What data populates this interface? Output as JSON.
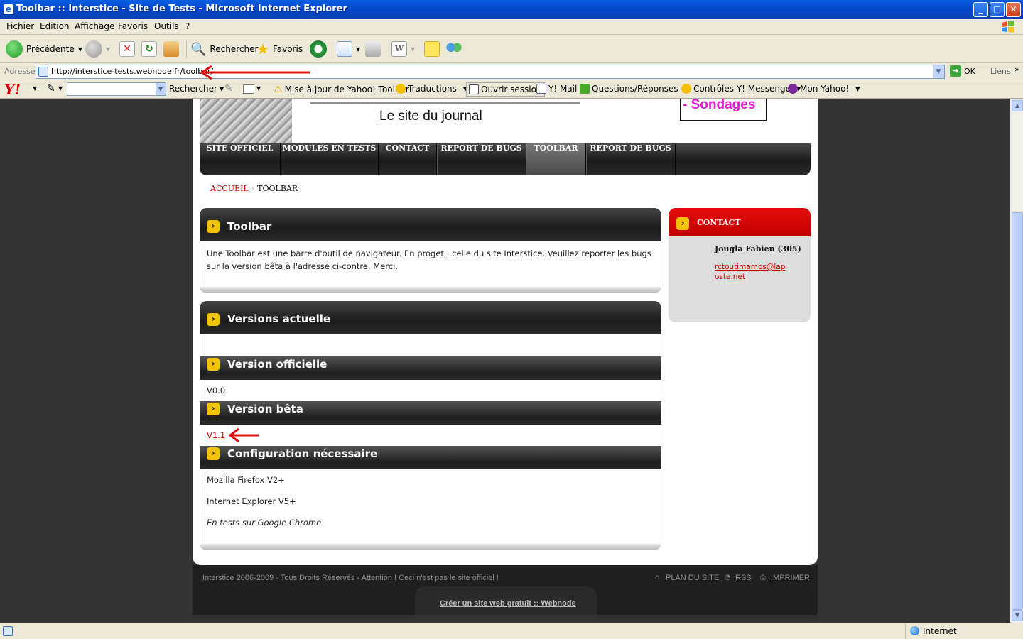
{
  "window": {
    "title": "Toolbar :: Interstice - Site de Tests - Microsoft Internet Explorer",
    "min": "_",
    "max": "□",
    "close": "✕"
  },
  "menu": [
    "Fichier",
    "Edition",
    "Affichage",
    "Favoris",
    "Outils",
    "?"
  ],
  "toolbar": {
    "back": "Précédente",
    "search": "Rechercher",
    "favorites": "Favoris"
  },
  "address": {
    "label": "Adresse",
    "url": "http://interstice-tests.webnode.fr/toolbar/",
    "go": "OK",
    "links": "Liens"
  },
  "yahoo": {
    "search_label": "Rechercher",
    "update": "Mise à jour de Yahoo! Toolbar",
    "translations": "Traductions",
    "session": "Ouvrir session",
    "mail": "Y! Mail",
    "answers": "Questions/Réponses",
    "messenger": "Contrôles Y! Messenger",
    "my_yahoo": "Mon Yahoo!"
  },
  "site": {
    "journal": "Le site du journal",
    "sondages": "- Sondages",
    "nav": [
      "SITE OFFICIEL",
      "MODULES EN TESTS",
      "CONTACT",
      "REPORT DE BUGS",
      "TOOLBAR",
      "REPORT DE BUGS"
    ],
    "breadcrumb": {
      "home": "ACCUEIL",
      "current": "TOOLBAR"
    },
    "toolbar_box": {
      "title": "Toolbar",
      "text": "Une Toolbar est une barre d'outil de navigateur. En proget : celle du site Interstice. Veuillez reporter les bugs sur la version bêta à l'adresse ci-contre. Merci."
    },
    "versions_box": {
      "title": "Versions actuelle",
      "official_title": "Version officielle",
      "official_value": "V0.0",
      "beta_title": "Version bêta",
      "beta_value": "V1.1",
      "config_title": "Configuration nécessaire",
      "config": [
        "Mozilla Firefox V2+",
        "Internet Explorer V5+",
        "En tests sur Google Chrome"
      ]
    },
    "contact": {
      "title": "CONTACT",
      "name": "Jougla Fabien (305)",
      "email": "rctoutimamos@laposte.net"
    },
    "footer": {
      "copyright": "Interstice 2006-2009 - Tous Droits Réservés - Attention ! Ceci n'est pas le site officiel !",
      "sitemap": "PLAN DU SITE",
      "rss": "RSS",
      "print": "IMPRIMER",
      "webnode": "Créer un site web gratuit :: Webnode"
    }
  },
  "status": {
    "zone": "Internet"
  },
  "colors": {
    "accent_red": "#cc0000",
    "nav_dark": "#1c1c1c",
    "bullet_yellow": "#f2c300",
    "sondages_magenta": "#e21bd4"
  }
}
